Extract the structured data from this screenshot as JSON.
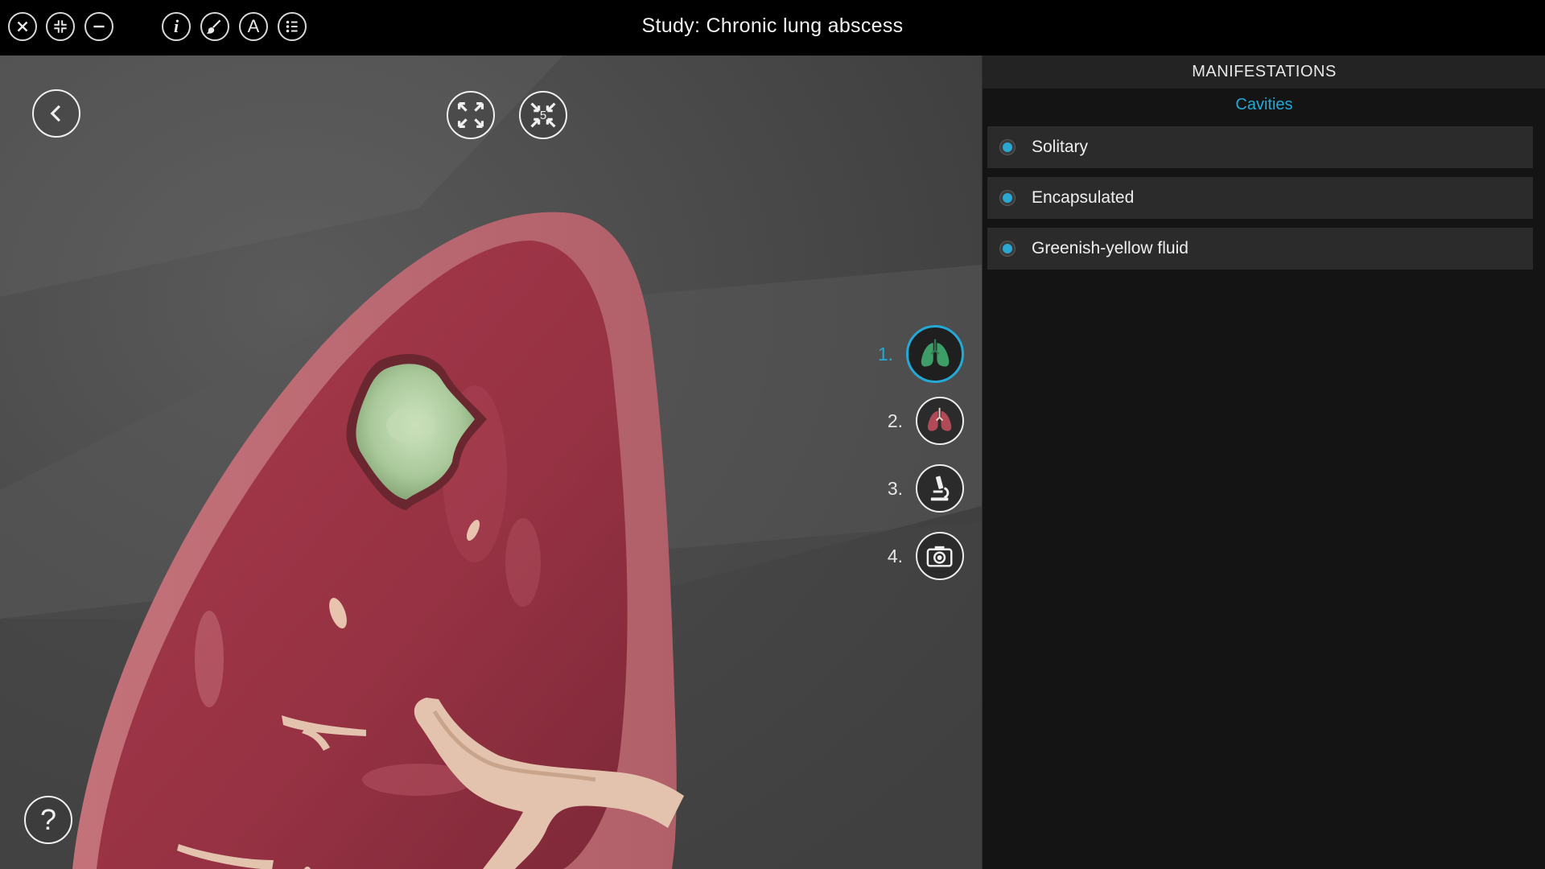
{
  "topbar": {
    "title": "Study: Chronic lung abscess",
    "buttons": [
      {
        "name": "close-icon"
      },
      {
        "name": "collapse-icon"
      },
      {
        "name": "minimize-icon"
      },
      {
        "name": "info-icon",
        "glyph": "i"
      },
      {
        "name": "brush-icon"
      },
      {
        "name": "annotation-icon",
        "glyph": "A"
      },
      {
        "name": "list-icon"
      }
    ]
  },
  "viewport": {
    "back_button": "chevron-left-icon",
    "view_buttons": [
      "expand-icon",
      "fit-icon"
    ],
    "fit_badge": "5",
    "help_glyph": "?",
    "steps": [
      {
        "number": "1.",
        "icon": "lungs-green-icon",
        "active": true
      },
      {
        "number": "2.",
        "icon": "lungs-red-icon",
        "active": false
      },
      {
        "number": "3.",
        "icon": "microscope-icon",
        "active": false
      },
      {
        "number": "4.",
        "icon": "camera-icon",
        "active": false
      }
    ]
  },
  "panel": {
    "header": "MANIFESTATIONS",
    "subheader": "Cavities",
    "items": [
      {
        "label": "Solitary"
      },
      {
        "label": "Encapsulated"
      },
      {
        "label": "Greenish-yellow fluid"
      }
    ]
  },
  "colors": {
    "accent": "#23a9d6",
    "lung": "#9e3545",
    "abscess": "#b7d3a8",
    "vessel": "#e0bfa8"
  }
}
